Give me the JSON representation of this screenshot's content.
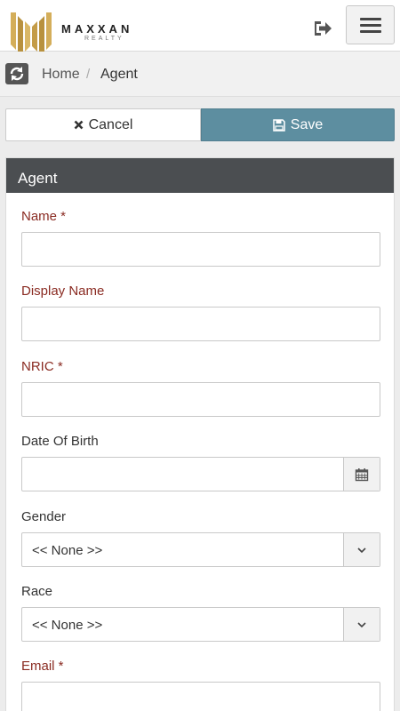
{
  "brand": {
    "name": "MAXXAN",
    "sub": "REALTY",
    "gold": "#c9a24a"
  },
  "breadcrumb": {
    "home": "Home",
    "separator": "/",
    "current": "Agent"
  },
  "actions": {
    "cancel": "Cancel",
    "save": "Save",
    "save_color": "#5d8ea0"
  },
  "panel": {
    "title": "Agent"
  },
  "form": {
    "name": {
      "label": "Name *",
      "value": ""
    },
    "display_name": {
      "label": "Display Name",
      "value": ""
    },
    "nric": {
      "label": "NRIC *",
      "value": ""
    },
    "dob": {
      "label": "Date Of Birth",
      "value": ""
    },
    "gender": {
      "label": "Gender",
      "selected": "<< None >>"
    },
    "race": {
      "label": "Race",
      "selected": "<< None >>"
    },
    "email": {
      "label": "Email *",
      "value": ""
    }
  },
  "icons": [
    "logout-icon",
    "hamburger-icon",
    "refresh-icon",
    "times-icon",
    "floppy-disk-icon",
    "calendar-icon",
    "chevron-down-icon"
  ],
  "colors": {
    "required_label": "#8a2b22",
    "panel_header": "#4b4e51"
  }
}
